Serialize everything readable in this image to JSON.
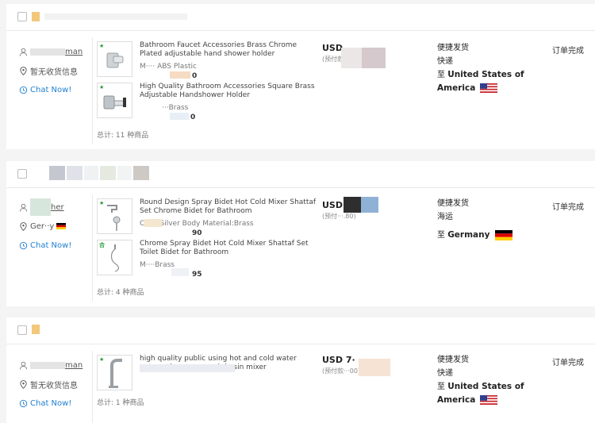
{
  "orders": [
    {
      "buyer": {
        "name": "man",
        "location": "暂无收货信息",
        "chat": "Chat Now!"
      },
      "products": [
        {
          "title": "Bathroom Faucet Accessories Brass Chrome Plated adjustable hand shower holder",
          "attr": "M···· ABS Plastic",
          "price": "0",
          "tag": "★"
        },
        {
          "title": "High Quality Bathroom Accessories Square Brass Adjustable Handshower Holder",
          "attr": "···Brass",
          "price": "0",
          "tag": "★"
        }
      ],
      "total": "总计: 11 种商品",
      "amount": {
        "usd": "USD",
        "prepaid": "(预付款···94)"
      },
      "shipping": {
        "method": "便捷发货",
        "carrier": "快递",
        "dest_prefix": "至",
        "dest_line1": "United States of",
        "dest_line2": "America"
      },
      "status": "订单完成"
    },
    {
      "buyer": {
        "name": "her",
        "location": "Ger··y",
        "chat": "Chat Now!"
      },
      "products": [
        {
          "title": "Round Design Spray Bidet Hot Cold Mixer Shattaf Set Chrome Bidet for Bathroom",
          "attr": "Colo··Silver Body Material:Brass",
          "price": "90",
          "tag": "★"
        },
        {
          "title": "Chrome Spray Bidet Hot Cold Mixer Shattaf Set Toilet Bidet for Bathroom",
          "attr": "M····Brass",
          "price": "95",
          "tag": "合"
        }
      ],
      "total": "总计: 4 种商品",
      "amount": {
        "usd": "USD",
        "prepaid": "(预付···.80)"
      },
      "shipping": {
        "method": "便捷发货",
        "carrier": "海运",
        "dest_prefix": "至",
        "dest_line1": "Germany",
        "dest_line2": ""
      },
      "status": "订单完成"
    },
    {
      "buyer": {
        "name": "man",
        "location": "暂无收货信息",
        "chat": "Chat Now!"
      },
      "products": [
        {
          "title": "high quality public using hot and cold water automatic sensor wash basin mixer",
          "attr": "",
          "price": "",
          "tag": "★"
        }
      ],
      "total": "总计: 1 种商品",
      "amount": {
        "usd": "USD 7·",
        "prepaid": "(预付款···00)"
      },
      "shipping": {
        "method": "便捷发货",
        "carrier": "快递",
        "dest_prefix": "至",
        "dest_line1": "United States of",
        "dest_line2": "America"
      },
      "status": "订单完成"
    }
  ],
  "colors": {
    "chat_link": "#1e7fd0",
    "tag_green": "#2a9a3e"
  }
}
